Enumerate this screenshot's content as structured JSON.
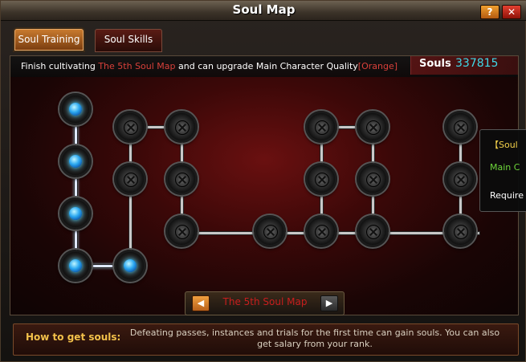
{
  "window": {
    "title": "Soul Map",
    "help_label": "?",
    "close_label": "✕"
  },
  "tabs": [
    {
      "label": "Soul Training",
      "active": true
    },
    {
      "label": "Soul Skills",
      "active": false
    }
  ],
  "info": {
    "prefix": "Finish cultivating ",
    "map_name": "The 5th Soul Map",
    "middle": " and can upgrade Main Character Quality",
    "quality": "[Orange]"
  },
  "souls": {
    "label": "Souls",
    "value": "337815"
  },
  "tooltip": {
    "line1": "【Soul",
    "line2": "Main C",
    "line3": "Require"
  },
  "navigator": {
    "map_name": "The 5th Soul Map",
    "prev_icon": "arrow-left-icon",
    "next_icon": "arrow-right-icon"
  },
  "how_to": {
    "label": "How to get souls",
    "colon": ":",
    "text": "Defeating passes, instances and trials for the first time can gain souls. You can also get salary from your rank."
  },
  "nodes": {
    "active_count": 5,
    "locked_count": 15
  }
}
